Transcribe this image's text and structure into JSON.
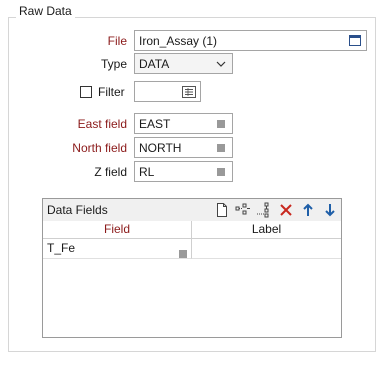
{
  "group": {
    "title": "Raw Data"
  },
  "form": {
    "file": {
      "label": "File",
      "value": "Iron_Assay (1)",
      "icon": "open-file-icon"
    },
    "type": {
      "label": "Type",
      "value": "DATA",
      "icon": "chevron-down-icon"
    },
    "filter": {
      "label": "Filter",
      "checked": false,
      "value": "",
      "icon": "filter-list-icon"
    },
    "east": {
      "label": "East field",
      "value": "EAST",
      "icon": "list-icon"
    },
    "north": {
      "label": "North field",
      "value": "NORTH",
      "icon": "list-icon"
    },
    "z": {
      "label": "Z field",
      "value": "RL",
      "icon": "list-icon"
    }
  },
  "data_fields": {
    "title": "Data Fields",
    "toolbar": [
      "new-row-icon",
      "insert-row-icon",
      "insert-after-icon",
      "delete-icon",
      "move-up-icon",
      "move-down-icon"
    ],
    "columns": [
      {
        "label": "Field"
      },
      {
        "label": "Label"
      }
    ],
    "rows": [
      {
        "field": "T_Fe",
        "label": ""
      }
    ]
  },
  "colors": {
    "required_label": "#8b1a1a",
    "delete_icon": "#c8281e",
    "arrow_icon": "#1f5fa8"
  }
}
